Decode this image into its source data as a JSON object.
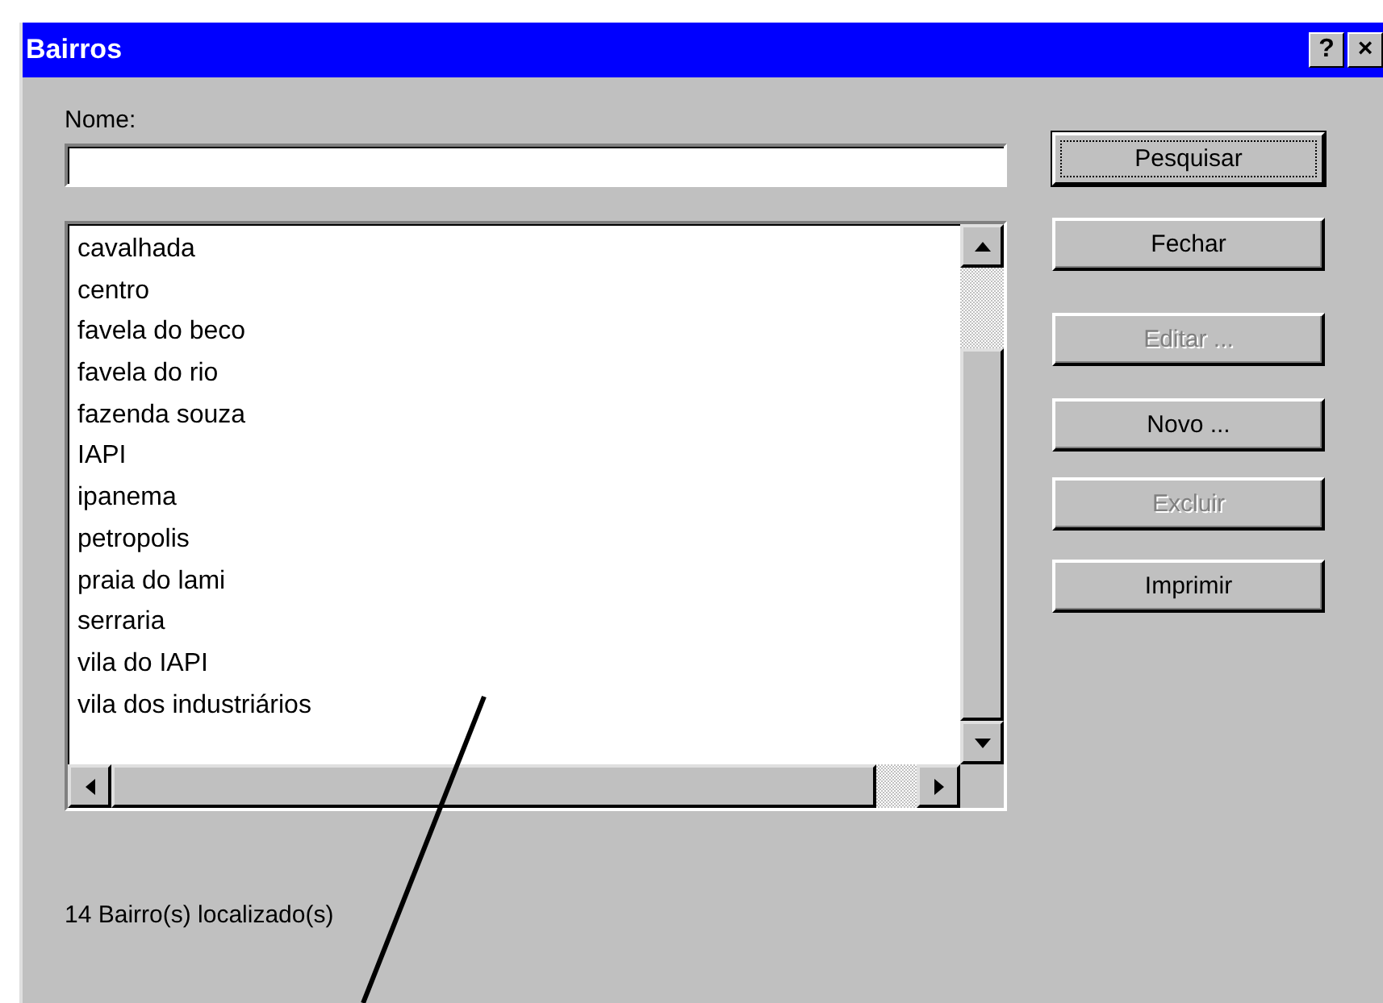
{
  "window": {
    "title": "Bairros",
    "title_buttons": [
      "?",
      "×"
    ]
  },
  "name_field": {
    "label": "Nome:"
  },
  "list": {
    "items": [
      "cavalhada",
      "centro",
      "favela do beco",
      "favela do rio",
      "fazenda souza",
      "IAPI",
      "ipanema",
      "petropolis",
      "praia do lami",
      "serraria",
      "vila do IAPI",
      "vila dos industriários"
    ]
  },
  "buttons": [
    {
      "label": "Pesquisar",
      "disabled": false,
      "default": true
    },
    {
      "label": "Fechar",
      "disabled": false,
      "default": false
    },
    {
      "label": "Editar ...",
      "disabled": true,
      "default": false
    },
    {
      "label": "Novo ...",
      "disabled": false,
      "default": false
    },
    {
      "label": "Excluir",
      "disabled": true,
      "default": false
    },
    {
      "label": "Imprimir",
      "disabled": false,
      "default": false
    }
  ],
  "status": "14 Bairro(s) localizado(s)"
}
